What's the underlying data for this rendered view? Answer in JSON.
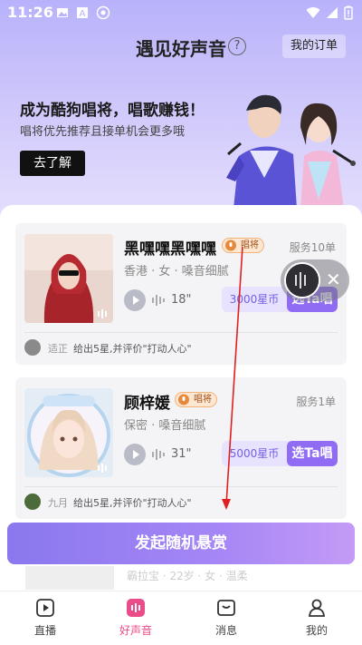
{
  "status_bar": {
    "time": "11:26"
  },
  "header": {
    "title": "遇见好声音",
    "help": "?",
    "orders_label": "我的订单"
  },
  "banner": {
    "title": "成为酷狗唱将，唱歌赚钱！",
    "subtitle": "唱将优先推荐且接单机会更多哦",
    "cta_label": "去了解"
  },
  "singers": [
    {
      "name": "黑嘿嘿黑嘿嘿",
      "tag": "唱将",
      "served": "服务10单",
      "meta": "香港 · 女 · 嗓音细腻",
      "duration": "18\"",
      "price": "3000星币",
      "pick_label": "选Ta唱",
      "review_user": "适正",
      "review_text": "给出5星,并评价\"打动人心\""
    },
    {
      "name": "顾梓媛",
      "tag": "唱将",
      "served": "服务1单",
      "meta": "保密 · 嗓音细腻",
      "duration": "31\"",
      "price": "5000星币",
      "pick_label": "选Ta唱",
      "review_user": "九月",
      "review_text": "给出5星,并评价\"打动人心\""
    }
  ],
  "peek_text": "霸拉宝 · 22岁 · 女 · 温柔",
  "reward_button": "发起随机悬赏",
  "nav": [
    {
      "label": "直播",
      "icon": "live-icon"
    },
    {
      "label": "好声音",
      "icon": "good-voice-icon"
    },
    {
      "label": "消息",
      "icon": "message-icon"
    },
    {
      "label": "我的",
      "icon": "profile-icon"
    }
  ],
  "colors": {
    "accent": "#8f6cf3",
    "nav_active": "#ea4c89",
    "hero_top": "#b8b2fb"
  }
}
